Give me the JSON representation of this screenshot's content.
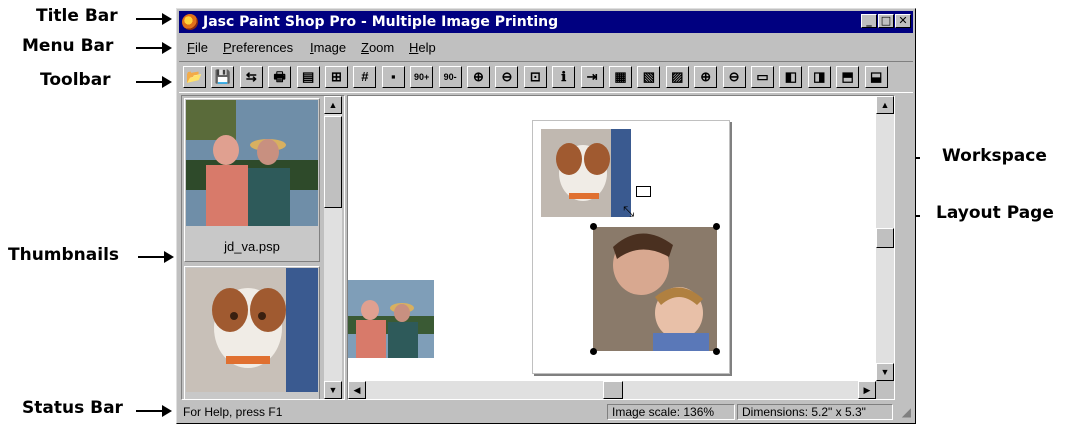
{
  "callouts": {
    "title_bar": "Title Bar",
    "menu_bar": "Menu Bar",
    "toolbar": "Toolbar",
    "thumbnails": "Thumbnails",
    "status_bar": "Status Bar",
    "workspace": "Workspace",
    "layout_page": "Layout Page"
  },
  "window": {
    "title": "Jasc Paint Shop Pro - Multiple Image Printing",
    "caption_buttons": {
      "minimize": "_",
      "maximize": "□",
      "close": "✕"
    }
  },
  "menu": [
    {
      "key": "F",
      "rest": "ile"
    },
    {
      "key": "P",
      "rest": "references"
    },
    {
      "key": "I",
      "rest": "mage"
    },
    {
      "key": "Z",
      "rest": "oom"
    },
    {
      "key": "H",
      "rest": "elp"
    }
  ],
  "toolbar": [
    {
      "name": "open-icon",
      "glyph": "📂"
    },
    {
      "name": "save-icon",
      "glyph": "💾"
    },
    {
      "name": "template-icon",
      "glyph": "⇆"
    },
    {
      "name": "print-icon",
      "glyph": "🖶"
    },
    {
      "name": "page-setup-icon",
      "glyph": "▤"
    },
    {
      "name": "arrange-icon",
      "glyph": "⊞"
    },
    {
      "name": "grid-icon",
      "glyph": "#"
    },
    {
      "name": "snap-icon",
      "glyph": "▪"
    },
    {
      "name": "rotate-right-icon",
      "glyph": "90+"
    },
    {
      "name": "rotate-left-icon",
      "glyph": "90-"
    },
    {
      "name": "zoom-in-icon",
      "glyph": "⊕"
    },
    {
      "name": "zoom-out-icon",
      "glyph": "⊖"
    },
    {
      "name": "zoom-full-icon",
      "glyph": "⊡"
    },
    {
      "name": "info-icon",
      "glyph": "ℹ"
    },
    {
      "name": "import-icon",
      "glyph": "⇥"
    },
    {
      "name": "fit-page-icon",
      "glyph": "▦"
    },
    {
      "name": "fit-width-icon",
      "glyph": "▧"
    },
    {
      "name": "fit-height-icon",
      "glyph": "▨"
    },
    {
      "name": "enlarge-icon",
      "glyph": "⊕"
    },
    {
      "name": "shrink-icon",
      "glyph": "⊖"
    },
    {
      "name": "center-icon",
      "glyph": "▭"
    },
    {
      "name": "align-left-icon",
      "glyph": "◧"
    },
    {
      "name": "align-right-icon",
      "glyph": "◨"
    },
    {
      "name": "align-top-icon",
      "glyph": "⬒"
    },
    {
      "name": "align-bottom-icon",
      "glyph": "⬓"
    }
  ],
  "thumbnails": [
    {
      "label": "jd_va.psp"
    },
    {
      "label": ""
    }
  ],
  "status": {
    "help": "For Help, press F1",
    "scale": "Image scale: 136%",
    "dimensions": "Dimensions: 5.2\" x 5.3\""
  },
  "colors": {
    "title_bar": "#000080",
    "window_face": "#c0c0c0",
    "workspace": "#ffffff"
  }
}
